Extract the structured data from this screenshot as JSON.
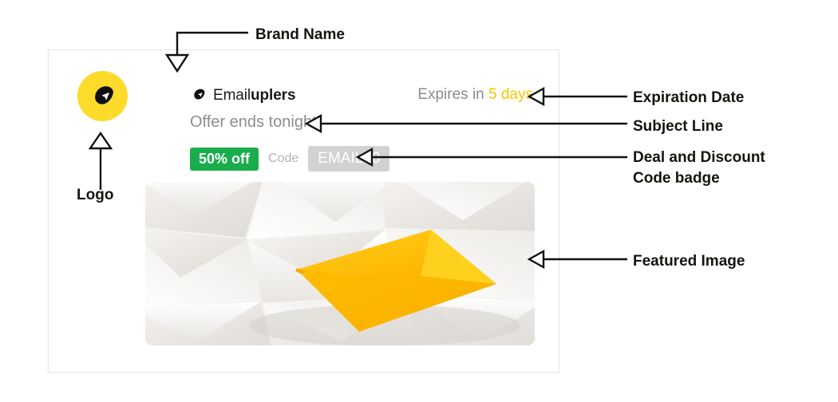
{
  "card": {
    "logo": {
      "icon": "emailuplers-logo-icon",
      "circle_color": "#fcdb2b",
      "mark_color": "#111111"
    },
    "brand": {
      "icon": "emailuplers-brand-icon",
      "name_light": "Email",
      "name_bold": "uplers"
    },
    "expiry": {
      "prefix": "Expires in",
      "value": "5 days",
      "value_color": "#f7c600"
    },
    "subject_line": "Offer ends tonight!",
    "deal": {
      "badge_label": "50% off",
      "badge_color": "#1aad4b",
      "code_label": "Code",
      "code_value": "EMAIL50",
      "code_bg": "#d2d2d2"
    },
    "featured_image": {
      "alt": "white envelopes pattern with one yellow envelope",
      "highlight_color": "#fdc300"
    }
  },
  "annotations": {
    "brand_name": "Brand Name",
    "logo": "Logo",
    "expiration_date": "Expiration Date",
    "subject_line": "Subject Line",
    "deal_and_discount": "Deal and Discount\nCode badge",
    "featured_image": "Featured Image"
  }
}
